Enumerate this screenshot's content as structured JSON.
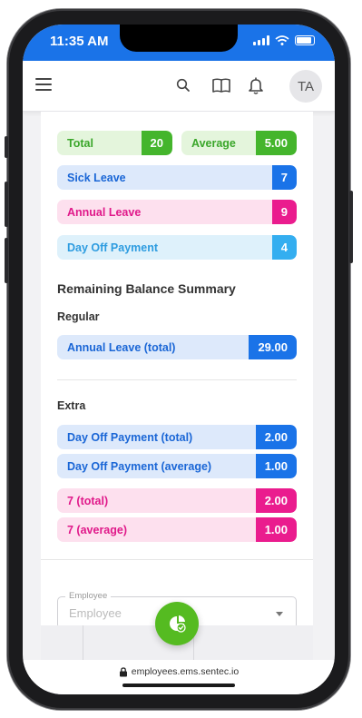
{
  "status_bar": {
    "time": "11:35 AM"
  },
  "app_bar": {
    "avatar_initials": "TA"
  },
  "summary": {
    "total": {
      "label": "Total",
      "value": "20"
    },
    "average": {
      "label": "Average",
      "value": "5.00"
    },
    "leaves": [
      {
        "label": "Sick Leave",
        "value": "7"
      },
      {
        "label": "Annual Leave",
        "value": "9"
      },
      {
        "label": "Day Off Payment",
        "value": "4"
      }
    ]
  },
  "remaining": {
    "title": "Remaining Balance Summary",
    "regular": {
      "title": "Regular",
      "items": [
        {
          "label": "Annual Leave (total)",
          "value": "29.00"
        }
      ]
    },
    "extra": {
      "title": "Extra",
      "items": [
        {
          "label": "Day Off Payment (total)",
          "value": "2.00"
        },
        {
          "label": "Day Off Payment (average)",
          "value": "1.00"
        },
        {
          "label": "7 (total)",
          "value": "2.00"
        },
        {
          "label": "7 (average)",
          "value": "1.00"
        }
      ]
    }
  },
  "employee_field": {
    "label": "Employee",
    "placeholder": "Employee"
  },
  "url_bar": {
    "url": "employees.ems.sentec.io"
  },
  "colors": {
    "primary_blue": "#1a73e8",
    "green": "#44b52c",
    "pink": "#ea1c8e",
    "light_blue": "#34aef0"
  },
  "icons": [
    "menu-icon",
    "search-icon",
    "book-icon",
    "bell-icon",
    "pie-chart-check-icon",
    "lock-icon"
  ]
}
